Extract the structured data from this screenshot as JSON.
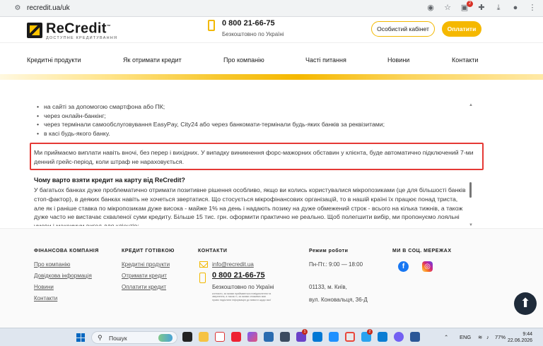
{
  "browser": {
    "url": "recredit.ua/uk",
    "ext_badge": "2"
  },
  "header": {
    "logo_name": "ReCredit",
    "logo_tm": "™",
    "logo_tagline": "ДОСТУПНЕ КРЕДИТУВАННЯ",
    "phone": "0 800 21-66-75",
    "phone_sub": "Безкоштовно по Україні",
    "cabinet_btn": "Особистий кабінет",
    "pay_btn": "Оплатити"
  },
  "nav": {
    "items": [
      "Кредитні продукти",
      "Як отримати кредит",
      "Про компанію",
      "Часті питання",
      "Новини",
      "Контакти"
    ]
  },
  "content": {
    "bullets": [
      "на сайті за допомогою смартфона або ПК;",
      "через онлайн-банкінг;",
      "через термінали самообслуговування EasyPay, City24 або через банкомати-термінали будь-яких банків за реквізитами;",
      "в касі будь-якого банку."
    ],
    "highlight_text": "Ми приймаємо виплати навіть вночі, без перер і вихідних. У випадку виникнення форс-мажорних обставин у клієнта, буде автоматично підключений 7-ми денний грейс-період, коли штраф не нараховується.",
    "question_title": "Чому варто взяти кредит на карту від ReCredit?",
    "question_text": "У багатьох банках дуже проблематично отримати позитивне рішення особливо, якщо ви колись користувалися мікропозиками (це для більшості банків стоп-фактор), в деяких банках навіть не хочеться звертатися. Що стосується мікрофінансових організацій, то в нашій країні їх працює понад триста, але як і раніше ставка по мікропозикам дуже висока - майже 1% на день і надають позику на дуже обмежений строк - всього на кілька тижнів, а також дуже часто не вистачає схваленої суми кредиту. Більше 15 тис. грн. оформити практично не реально. Щоб полегшити вибір, ми пропонуємо лояльні умови і максимум вигод для клієнтів:"
  },
  "footer": {
    "col1": {
      "title": "ФІНАНСОВА КОМПАНІЯ",
      "links": [
        "Про компанію",
        "Довідкова інформація",
        "Новини",
        "Контакти"
      ]
    },
    "col2": {
      "title": "КРЕДИТ ГОТІВКОЮ",
      "links": [
        "Кредитні продукти",
        "Отримати кредит",
        "Оплатити кредит"
      ]
    },
    "col3": {
      "title": "КОНТАКТИ",
      "email": "info@recredit.ua",
      "phone": "0 800 21-66-75",
      "phone_sub": "Безкоштовно по Україні",
      "fine_print": "контакти, за якими приймаються повідомлення та звернення, а також ті, за якими споживач має право надіслати інформацію до вимоги щодо якої"
    },
    "col4": {
      "title": "Режим роботи",
      "hours": "Пн-Пт.: 9:00 — 18:00",
      "city": "01133, м. Київ,",
      "street": "вул. Коновальця, 36-Д"
    },
    "col5": {
      "title": "МИ В СОЦ. МЕРЕЖАХ"
    }
  },
  "taskbar": {
    "search_placeholder": "Пошук",
    "lang": "ENG",
    "battery": "77%",
    "time": "9:44",
    "date": "22.06.2026",
    "badge_a": "1",
    "badge_b": "2"
  },
  "colors": {
    "accent": "#f5b800",
    "highlight_border": "#e53935",
    "to_top": "#1f2b3a"
  }
}
